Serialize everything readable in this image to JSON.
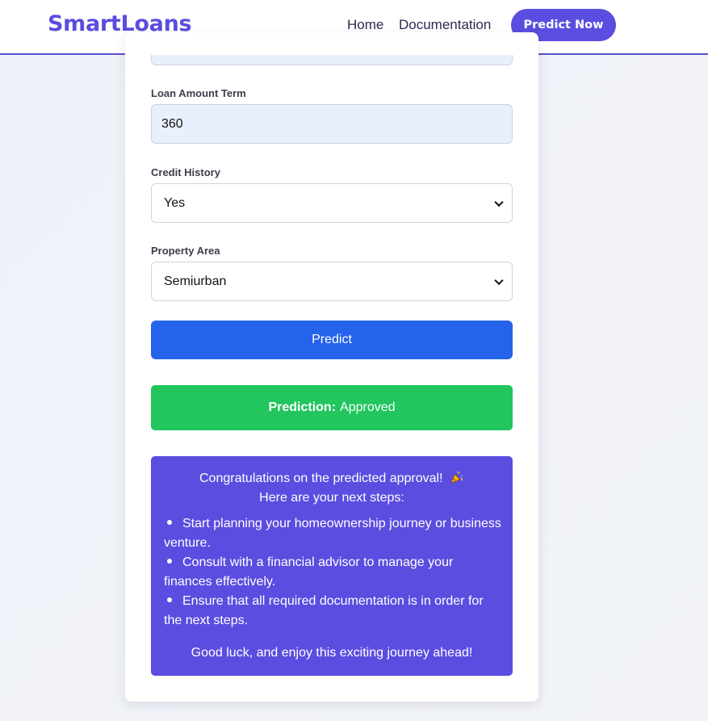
{
  "nav": {
    "brand": "SmartLoans",
    "links": [
      "Home",
      "Documentation"
    ],
    "cta": "Predict Now"
  },
  "form": {
    "loan_term": {
      "label": "Loan Amount Term",
      "value": "360"
    },
    "credit_history": {
      "label": "Credit History",
      "value": "Yes"
    },
    "property_area": {
      "label": "Property Area",
      "value": "Semiurban"
    },
    "submit_label": "Predict"
  },
  "result": {
    "label": "Prediction:",
    "value": "Approved"
  },
  "next_steps": {
    "headline": "Congratulations on the predicted approval!",
    "icon": "party-popper-icon",
    "subhead": "Here are your next steps:",
    "items": [
      "Start planning your homeownership journey or business venture.",
      "Consult with a financial advisor to manage your finances effectively.",
      "Ensure that all required documentation is in order for the next steps."
    ],
    "footer": "Good luck, and enjoy this exciting journey ahead!"
  },
  "colors": {
    "brand": "#5b4de0",
    "predict_button": "#2563eb",
    "success": "#22c55e"
  }
}
